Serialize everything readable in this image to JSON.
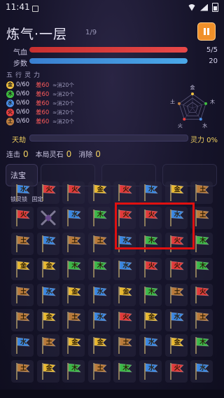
{
  "status_bar": {
    "time": "11:41"
  },
  "header": {
    "title": "炼气·一层",
    "level": "1/9"
  },
  "stats": {
    "hp": {
      "label": "气血",
      "value": "5/5",
      "fraction": 1.0,
      "color": "#e84848"
    },
    "steps": {
      "label": "步数",
      "value": "20",
      "fraction": 1.0,
      "color": "#4aa8e8"
    }
  },
  "elements": {
    "header": "五行灵力",
    "rows": [
      {
        "name": "金",
        "color": "#f0c040",
        "progress": "0/60",
        "diff": "差60",
        "hint": "≈消20个"
      },
      {
        "name": "木",
        "color": "#40c040",
        "progress": "0/60",
        "diff": "差60",
        "hint": "≈消20个"
      },
      {
        "name": "水",
        "color": "#4a90e8",
        "progress": "0/60",
        "diff": "差60",
        "hint": "≈消20个"
      },
      {
        "name": "火",
        "color": "#e84040",
        "progress": "0/60",
        "diff": "差60",
        "hint": "≈消20个"
      },
      {
        "name": "土",
        "color": "#c08040",
        "progress": "0/60",
        "diff": "差60",
        "hint": "≈消20个"
      }
    ]
  },
  "radar": {
    "labels": [
      "金",
      "木",
      "水",
      "火",
      "土"
    ]
  },
  "tianjie": {
    "label": "天劫",
    "fraction": 0.0
  },
  "lingli": {
    "text": "灵力 0%"
  },
  "counters": {
    "combo_label": "连击",
    "combo": "0",
    "stones_label": "本局灵石",
    "stones": "0",
    "clear_label": "消除",
    "clear": "0"
  },
  "fabao": {
    "label": "法宝",
    "tags": [
      "锁灵锁",
      "固定"
    ]
  },
  "board": {
    "rows": [
      [
        "水",
        "火",
        "火",
        "金",
        "火",
        "水",
        "金",
        "土"
      ],
      [
        "火",
        "X",
        "水",
        "木",
        "火",
        "火",
        "水",
        "土"
      ],
      [
        "土",
        "水",
        "土",
        "土",
        "水",
        "木",
        "火",
        "木"
      ],
      [
        "金",
        "金",
        "木",
        "木",
        "水",
        "火",
        "火",
        "木"
      ],
      [
        "土",
        "水",
        "金",
        "水",
        "金",
        "木",
        "土",
        "火"
      ],
      [
        "土",
        "金",
        "土",
        "水",
        "火",
        "金",
        "水",
        "土"
      ],
      [
        "水",
        "土",
        "金",
        "金",
        "土",
        "水",
        "金",
        "木"
      ],
      [
        "土",
        "金",
        "木",
        "土",
        "木",
        "水",
        "火",
        "水"
      ]
    ],
    "colors": {
      "金": "#e8b830",
      "木": "#3cb848",
      "水": "#3a86e0",
      "火": "#e03a3a",
      "土": "#b87a3a"
    }
  }
}
